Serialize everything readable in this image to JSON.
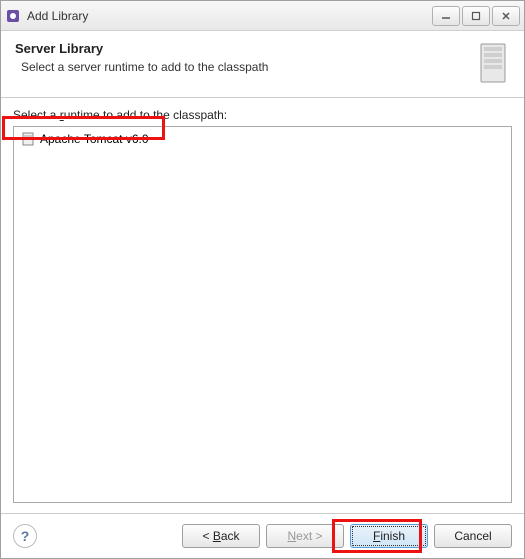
{
  "window": {
    "title": "Add Library"
  },
  "header": {
    "title": "Server Library",
    "subtitle": "Select a server runtime to add to the classpath"
  },
  "content": {
    "list_label": "Select a runtime to add to the classpath:",
    "items": [
      {
        "label": "Apache Tomcat v6.0"
      }
    ]
  },
  "buttons": {
    "help": "?",
    "back": "< Back",
    "next": "Next >",
    "finish": "Finish",
    "cancel": "Cancel"
  }
}
